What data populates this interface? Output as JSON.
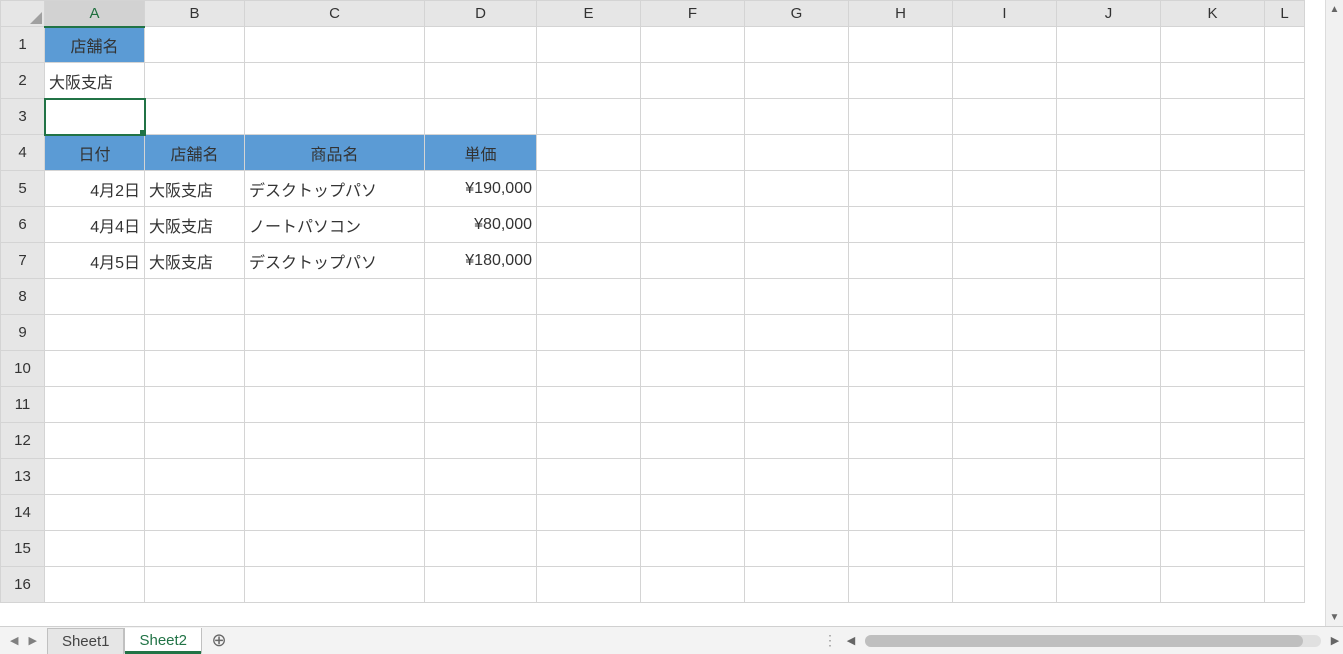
{
  "columns": [
    "A",
    "B",
    "C",
    "D",
    "E",
    "F",
    "G",
    "H",
    "I",
    "J",
    "K",
    "L"
  ],
  "rowCount": 16,
  "selected": {
    "col": "A",
    "row": 3
  },
  "header1": {
    "A": "店舗名"
  },
  "row2": {
    "A": "大阪支店"
  },
  "table_header": {
    "A": "日付",
    "B": "店舗名",
    "C": "商品名",
    "D": "単価"
  },
  "table_rows": [
    {
      "A": "4月2日",
      "B": "大阪支店",
      "C": "デスクトップパソ",
      "D": "¥190,000"
    },
    {
      "A": "4月4日",
      "B": "大阪支店",
      "C": "ノートパソコン",
      "D": "¥80,000"
    },
    {
      "A": "4月5日",
      "B": "大阪支店",
      "C": "デスクトップパソ",
      "D": "¥180,000"
    }
  ],
  "sheets": {
    "items": [
      "Sheet1",
      "Sheet2"
    ],
    "active": "Sheet2"
  },
  "icons": {
    "add_sheet": "⊕"
  }
}
